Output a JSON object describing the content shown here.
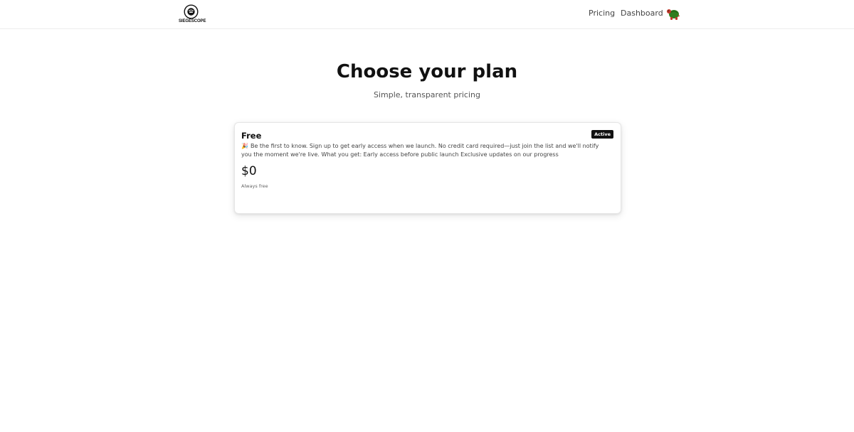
{
  "header": {
    "logo_text": "SIEGESCOPE",
    "nav": {
      "pricing_label": "Pricing",
      "dashboard_label": "Dashboard"
    },
    "avatar_icon": "turtle-avatar-icon"
  },
  "main": {
    "title": "Choose your plan",
    "subtitle": "Simple, transparent pricing"
  },
  "plan": {
    "name": "Free",
    "badge": "Active",
    "description_icon": "🎉",
    "description": "Be the first to know. Sign up to get early access when we launch. No credit card required—just join the list and we'll notify you the moment we're live. What you get: Early access before public launch Exclusive updates on our progress",
    "price": "$0",
    "note": "Always free"
  },
  "colors": {
    "badge_bg": "#111111",
    "text_primary": "#111111",
    "text_muted": "#555555",
    "border": "#e6e6e6"
  }
}
